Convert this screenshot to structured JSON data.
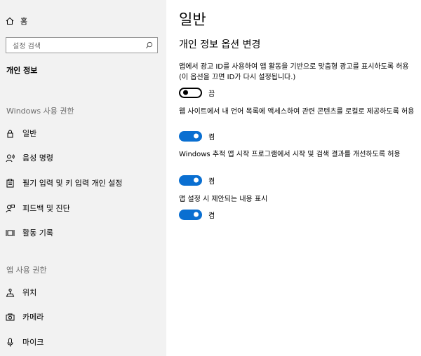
{
  "sidebar": {
    "home_label": "홈",
    "search_placeholder": "설정 검색",
    "current_page": "개인 정보",
    "section_windows": "Windows 사용 권한",
    "windows_items": [
      {
        "label": "일반",
        "icon": "lock-icon"
      },
      {
        "label": "음성 명령",
        "icon": "speech-icon"
      },
      {
        "label": "필기 입력 및 키 입력 개인 설정",
        "icon": "clipboard-icon"
      },
      {
        "label": "피드백 및 진단",
        "icon": "feedback-icon"
      },
      {
        "label": "활동 기록",
        "icon": "activity-icon"
      }
    ],
    "section_app": "앱 사용 권한",
    "app_items": [
      {
        "label": "위치",
        "icon": "location-icon"
      },
      {
        "label": "카메라",
        "icon": "camera-icon"
      },
      {
        "label": "마이크",
        "icon": "microphone-icon"
      }
    ]
  },
  "main": {
    "title": "일반",
    "subtitle": "개인 정보 옵션 변경",
    "options": [
      {
        "text": "앱에서 광고 ID를 사용하여 앱 활동을 기반으로 맞춤형 광고를 표시하도록 허용(이 옵션을 끄면 ID가 다시 설정됩니다.)",
        "state": "끔",
        "on": false
      },
      {
        "text": "웹 사이트에서 내 언어 목록에 액세스하여 관련 콘텐츠를 로컬로 제공하도록 허용",
        "state": "켬",
        "on": true
      },
      {
        "text": "Windows 추적 앱 시작 프로그램에서 시작 및 검색 결과를 개선하도록 허용",
        "state": "켬",
        "on": true
      },
      {
        "text": "앱 설정 시 제안되는 내용 표시",
        "state": "켬",
        "on": true
      }
    ]
  },
  "colors": {
    "sidebar_bg": "#f2f2f2",
    "toggle_on": "#0a6fd1",
    "muted_text": "#6d6d6d"
  }
}
